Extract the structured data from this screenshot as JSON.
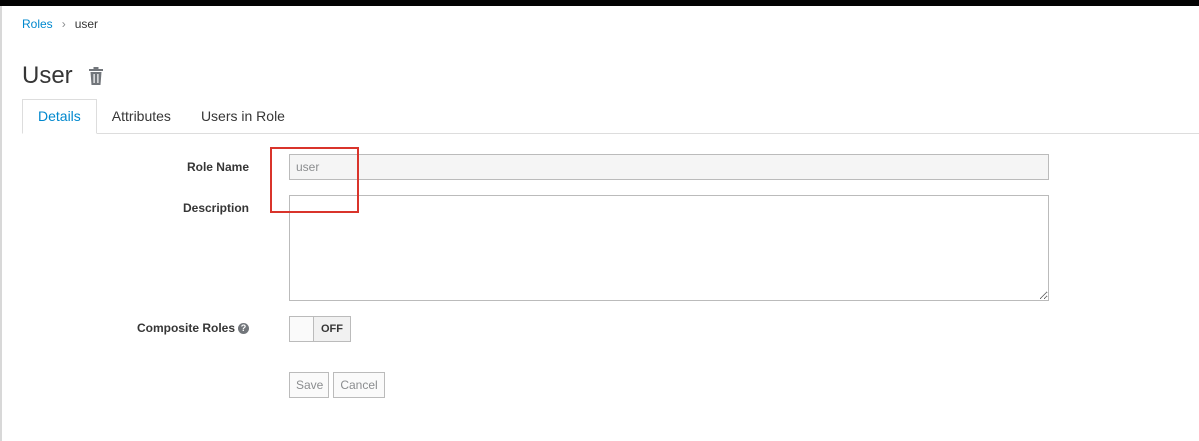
{
  "breadcrumb": {
    "parent": "Roles",
    "separator": "›",
    "current": "user"
  },
  "page": {
    "title": "User",
    "delete_icon": "trash-icon"
  },
  "tabs": [
    {
      "label": "Details",
      "active": true
    },
    {
      "label": "Attributes",
      "active": false
    },
    {
      "label": "Users in Role",
      "active": false
    }
  ],
  "form": {
    "role_name_label": "Role Name",
    "role_name_value": "user",
    "description_label": "Description",
    "description_value": "",
    "composite_label": "Composite Roles",
    "composite_help_icon": "question-circle-icon",
    "composite_help_glyph": "?",
    "composite_state": "OFF"
  },
  "buttons": {
    "save": "Save",
    "cancel": "Cancel"
  },
  "colors": {
    "link": "#0088ce",
    "highlight": "#d9342b",
    "topbar": "#030303"
  }
}
